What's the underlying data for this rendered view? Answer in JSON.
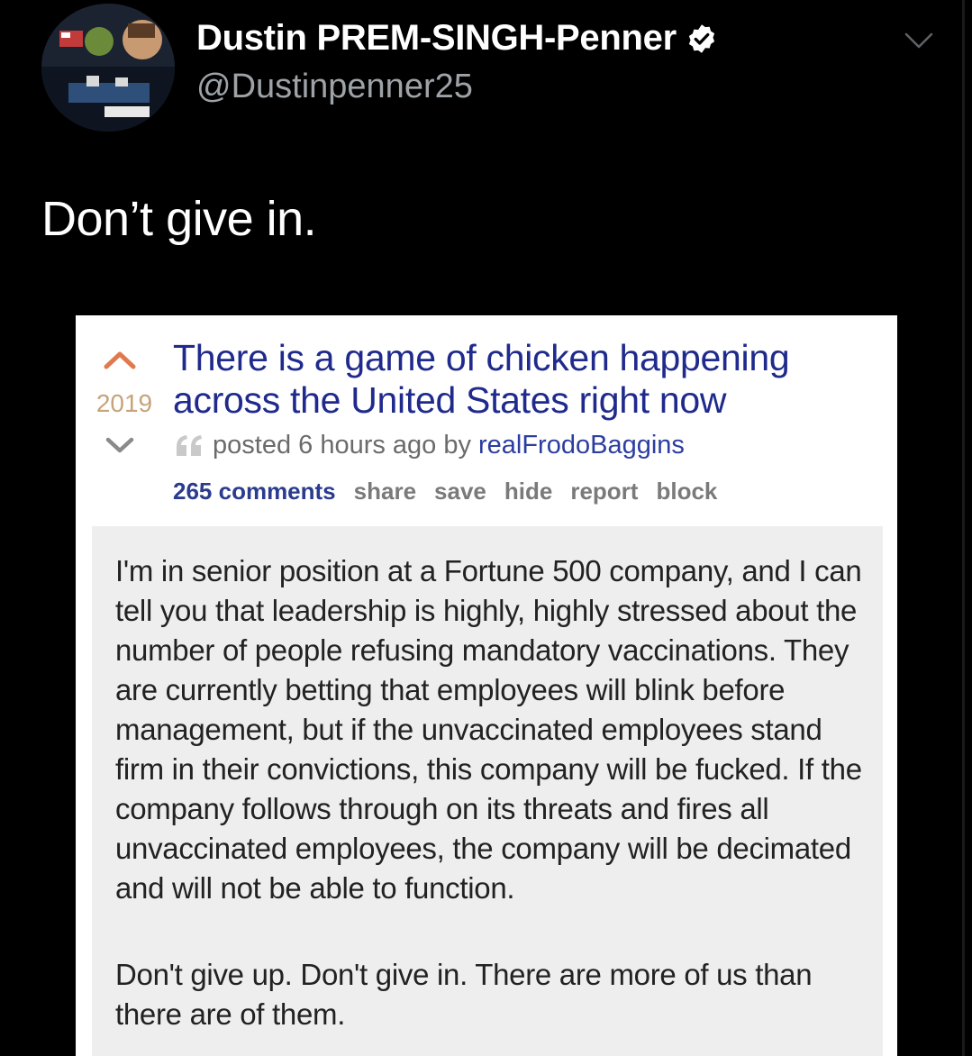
{
  "tweet": {
    "display_name": "Dustin PREM-SINGH-Penner",
    "handle": "@Dustinpenner25",
    "text": "Don’t give in.",
    "avatar_icon": "profile-avatar",
    "verified_icon": "verified-badge-icon",
    "menu_icon": "chevron-down-icon"
  },
  "reddit_post": {
    "score": "2019",
    "title": "There is a game of chicken happening across the United States right now",
    "tagline_prefix": "posted 6 hours ago by",
    "author": "realFrodoBaggins",
    "actions": {
      "comments": "265 comments",
      "share": "share",
      "save": "save",
      "hide": "hide",
      "report": "report",
      "block": "block"
    },
    "body": [
      "I'm in senior position at a Fortune 500 company, and I can tell you that leadership is highly, highly stressed about the number of people refusing mandatory vaccinations. They are currently betting that employees will blink before management, but if the unvaccinated employees stand firm in their convictions, this company will be fucked. If the company follows through on its threats and fires all unvaccinated employees, the company will be decimated and will not be able to function.",
      "Don't give up. Don't give in. There are more of us than there are of them."
    ]
  },
  "colors": {
    "background": "#000000",
    "title_link": "#1f2a8c",
    "upvote": "#e07a4e",
    "score": "#c6a37a",
    "selftext_bg": "#eeeeee"
  }
}
